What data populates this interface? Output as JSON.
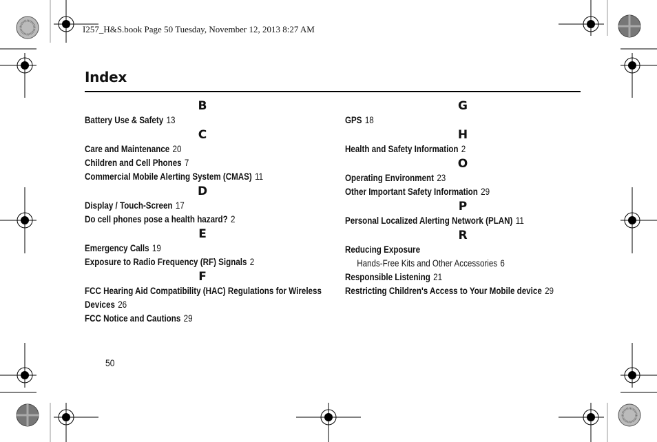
{
  "slug_line": "I257_H&S.book  Page 50  Tuesday, November 12, 2013  8:27 AM",
  "page_title": "Index",
  "page_number": "50",
  "left_column": [
    {
      "letter": "B",
      "entries": [
        {
          "term": "Battery Use & Safety",
          "page": "13"
        }
      ]
    },
    {
      "letter": "C",
      "entries": [
        {
          "term": "Care and Maintenance",
          "page": "20"
        },
        {
          "term": "Children and Cell Phones",
          "page": "7"
        },
        {
          "term": "Commercial Mobile Alerting System (CMAS)",
          "page": "11"
        }
      ]
    },
    {
      "letter": "D",
      "entries": [
        {
          "term": "Display / Touch-Screen",
          "page": "17"
        },
        {
          "term": "Do cell phones pose a health hazard?",
          "page": "2"
        }
      ]
    },
    {
      "letter": "E",
      "entries": [
        {
          "term": "Emergency Calls",
          "page": "19"
        },
        {
          "term": "Exposure to Radio Frequency (RF) Signals",
          "page": "2"
        }
      ]
    },
    {
      "letter": "F",
      "entries": [
        {
          "term": "FCC Hearing Aid Compatibility (HAC) Regulations for Wireless Devices",
          "page": "26"
        },
        {
          "term": "FCC Notice and Cautions",
          "page": "29"
        }
      ]
    }
  ],
  "right_column": [
    {
      "letter": "G",
      "entries": [
        {
          "term": "GPS",
          "page": "18"
        }
      ]
    },
    {
      "letter": "H",
      "entries": [
        {
          "term": "Health and Safety Information",
          "page": "2"
        }
      ]
    },
    {
      "letter": "O",
      "entries": [
        {
          "term": "Operating Environment",
          "page": "23"
        },
        {
          "term": "Other Important Safety Information",
          "page": "29"
        }
      ]
    },
    {
      "letter": "P",
      "entries": [
        {
          "term": "Personal Localized Alerting Network (PLAN)",
          "page": "11"
        }
      ]
    },
    {
      "letter": "R",
      "entries": [
        {
          "term": "Reducing Exposure",
          "page": ""
        },
        {
          "term": "Hands-Free Kits and Other Accessories",
          "page": "6",
          "sub": true
        },
        {
          "term": "Responsible Listening",
          "page": "21"
        },
        {
          "term": "Restricting Children's Access to Your Mobile device",
          "page": "29"
        }
      ]
    }
  ]
}
